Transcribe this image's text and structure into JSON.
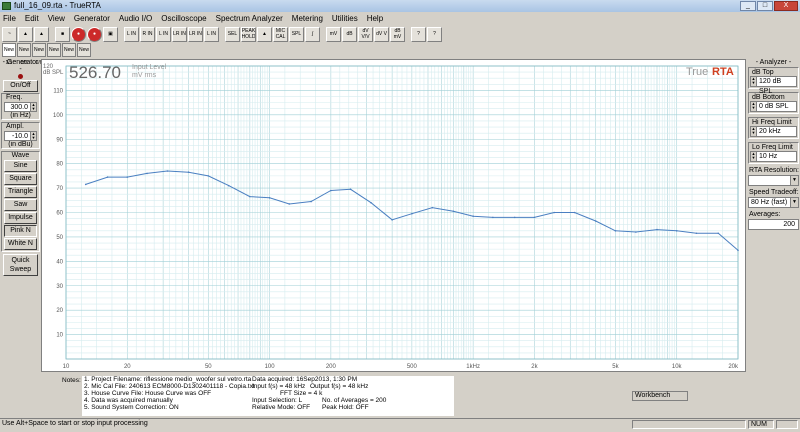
{
  "window": {
    "title": "full_16_09.rta - TrueRTA",
    "buttons": [
      "_",
      "□",
      "X"
    ]
  },
  "menu": [
    "File",
    "Edit",
    "View",
    "Generator",
    "Audio I/O",
    "Oscilloscope",
    "Spectrum Analyzer",
    "Metering",
    "Utilities",
    "Help"
  ],
  "toolbar": {
    "buttons": [
      "~",
      "▲",
      "▲",
      "■",
      "●",
      "●",
      "▣",
      "L\nIN",
      "R\nIN",
      "L\nIN",
      "LR\nIN",
      "LR\nIN",
      "L\nIN",
      "SEL",
      "PEAK\nHOLD",
      "▲",
      "MIC\nCAL",
      "SPL",
      "∫",
      "mV",
      "dB",
      "dV\nV/V",
      "dV\nV",
      "dB\nmV",
      "?",
      "?"
    ],
    "tabs": [
      "New\n1/1",
      "New\n1/3",
      "New\n1/6",
      "New\n1/12",
      "New\n1/24",
      "New\n1/48"
    ]
  },
  "generator": {
    "title": "- Generator -",
    "on_off": "On/Off",
    "freq_label": "Freq.",
    "freq_value": "300.0",
    "freq_unit": "(in Hz)",
    "ampl_label": "Ampl.",
    "ampl_value": "-10.0",
    "ampl_unit": "(in dBu)",
    "wave_label": "Wave",
    "waves": [
      "Sine",
      "Square",
      "Triangle",
      "Saw",
      "Impulse",
      "Pink N",
      "White N"
    ],
    "quick_sweep": "Quick Sweep"
  },
  "readout": {
    "unit": "dB SPL",
    "value": "526.70",
    "label1": "Input Level",
    "label2": "mV rms",
    "brand_true": "True",
    "brand_rta": "RTA"
  },
  "chart_data": {
    "type": "line",
    "ylabel": "dB SPL",
    "ylim": [
      0,
      120
    ],
    "yticks": [
      10,
      20,
      30,
      40,
      50,
      60,
      70,
      80,
      90,
      100,
      110
    ],
    "ytop_label": "120",
    "xlim": [
      10,
      20000
    ],
    "xscale": "log",
    "xticks": [
      {
        "v": 10,
        "label": "10"
      },
      {
        "v": 20,
        "label": "20"
      },
      {
        "v": 50,
        "label": "50"
      },
      {
        "v": 100,
        "label": "100"
      },
      {
        "v": 200,
        "label": "200"
      },
      {
        "v": 500,
        "label": "500"
      },
      {
        "v": 1000,
        "label": "1kHz"
      },
      {
        "v": 2000,
        "label": "2k"
      },
      {
        "v": 5000,
        "label": "5k"
      },
      {
        "v": 10000,
        "label": "10k"
      },
      {
        "v": 20000,
        "label": "20k"
      }
    ],
    "series": [
      {
        "color": "#4a7fc1",
        "x": [
          12.5,
          16,
          20,
          25,
          31.5,
          40,
          50,
          63,
          80,
          100,
          125,
          160,
          200,
          250,
          315,
          400,
          500,
          630,
          800,
          1000,
          1250,
          1600,
          2000,
          2500,
          3150,
          4000,
          5000,
          6300,
          8000,
          10000,
          12500,
          16000,
          20000
        ],
        "y": [
          71.5,
          74.5,
          74.5,
          76,
          77,
          76.5,
          75,
          71,
          66.5,
          66,
          63.5,
          64.5,
          69,
          69.5,
          64,
          57,
          59.5,
          62,
          60.5,
          58.5,
          58,
          58,
          58,
          60,
          60,
          56.5,
          52.5,
          52,
          53,
          52.5,
          51.5,
          51.5,
          44.5
        ]
      }
    ]
  },
  "analyzer": {
    "title": "- Analyzer -",
    "db_top_label": "dB Top",
    "db_top_value": "120 dB SPL",
    "db_bottom_label": "dB Bottom",
    "db_bottom_value": "0 dB SPL",
    "hi_freq_label": "Hi Freq Limit",
    "hi_freq_value": "20 kHz",
    "lo_freq_label": "Lo Freq Limit",
    "lo_freq_value": "10 Hz",
    "rta_res_label": "RTA Resolution:",
    "rta_res_value": "",
    "speed_label": "Speed Tradeoff:",
    "speed_value": "80 Hz (fast)",
    "averages_label": "Averages:",
    "averages_value": "200"
  },
  "notes": {
    "label": "Notes:",
    "lines": [
      [
        "1. Project Filename: riflessione medio_woofer sul vetro.rta",
        "Data acquired: 16Sep2013, 1:30 PM",
        ""
      ],
      [
        "2. Mic Cal File: 240613 ECM8000-D1302401118 - Copia.txt",
        "Input f(s) = 48 kHz",
        "Output f(s) = 48 kHz"
      ],
      [
        "3. House Curve File: House Curve was OFF",
        "",
        "FFT Size = 4 k"
      ],
      [
        "4. Data was acquired manually",
        "Input Selection: L",
        "No. of Averages = 200"
      ],
      [
        "5. Sound System Correction: ON",
        "Relative Mode: OFF",
        "Peak Hold: OFF"
      ]
    ],
    "workbench": "Workbench"
  },
  "status": {
    "text": "Use Alt+Space to start or stop input processing",
    "num": "NUM"
  }
}
